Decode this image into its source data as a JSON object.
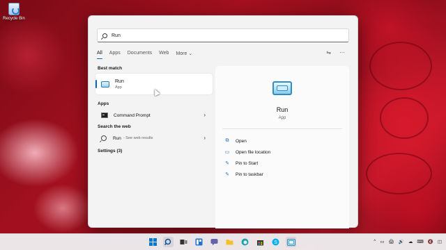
{
  "desktop": {
    "recycle_bin_label": "Recycle Bin"
  },
  "search": {
    "query": "Run"
  },
  "tabs": [
    "All",
    "Apps",
    "Documents",
    "Web",
    "More"
  ],
  "tabs_more_chevron": "⌄",
  "top_icons": {
    "share": "⇋",
    "more": "···"
  },
  "best_match": {
    "section_title": "Best match",
    "name": "Run",
    "sub": "App"
  },
  "apps": {
    "section_title": "Apps",
    "item_name": "Command Prompt",
    "chevron": "›"
  },
  "web": {
    "section_title": "Search the web",
    "item_name": "Run",
    "item_sub": "- See web results",
    "chevron": "›"
  },
  "settings": {
    "section_title": "Settings (3)"
  },
  "preview": {
    "name": "Run",
    "sub": "App",
    "actions": [
      {
        "label": "Open",
        "glyph": "⧉"
      },
      {
        "label": "Open file location",
        "glyph": "▭"
      },
      {
        "label": "Pin to Start",
        "glyph": "✎"
      },
      {
        "label": "Pin to taskbar",
        "glyph": "✎"
      }
    ]
  },
  "taskbar": {
    "icons": [
      "search-icon",
      "task-view-icon",
      "widgets-icon",
      "chat-icon",
      "file-explorer-icon",
      "edge-icon",
      "store-icon",
      "skype-icon",
      "run-icon"
    ],
    "tray": {
      "chevron": "^",
      "items": [
        "▭",
        "🖨",
        "🔊",
        "☁",
        "⌨",
        "🔇",
        "◫"
      ]
    }
  },
  "colors": {
    "accent": "#0067c0",
    "panel": "#f3f3f3"
  }
}
